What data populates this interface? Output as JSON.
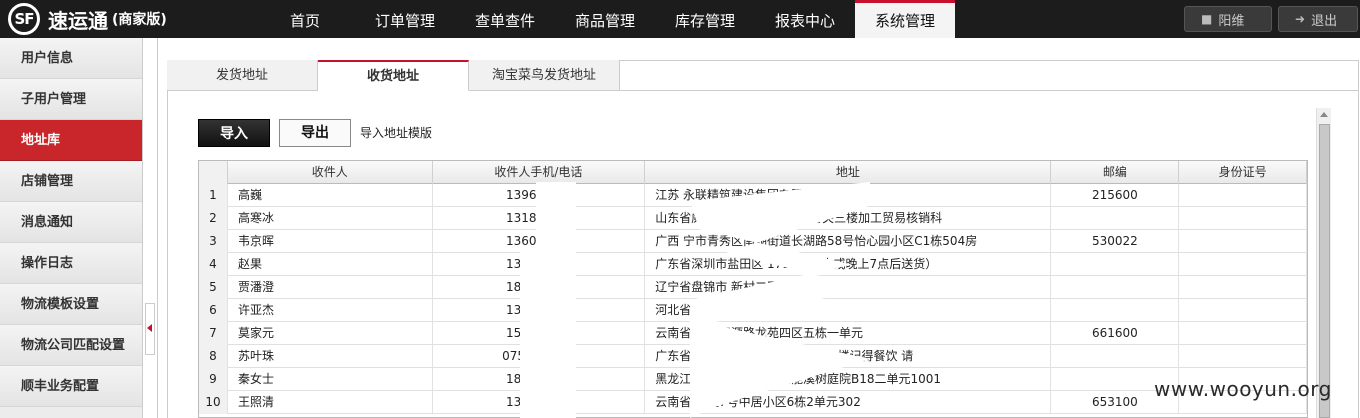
{
  "brand": {
    "mark": "SF",
    "name": "速运通",
    "edition": "(商家版)"
  },
  "nav": [
    "首页",
    "订单管理",
    "查单查件",
    "商品管理",
    "库存管理",
    "报表中心",
    "系统管理"
  ],
  "top_buttons": {
    "user": "阳维",
    "logout": "退出"
  },
  "sidebar": [
    "用户信息",
    "子用户管理",
    "地址库",
    "店铺管理",
    "消息通知",
    "操作日志",
    "物流模板设置",
    "物流公司匹配设置",
    "顺丰业务配置"
  ],
  "tabs": [
    "发货地址",
    "收货地址",
    "淘宝菜鸟发货地址"
  ],
  "toolbar": {
    "import": "导入",
    "export": "导出",
    "template": "导入地址模版"
  },
  "table": {
    "columns": [
      "收件人",
      "收件人手机/电话",
      "地址",
      "邮编",
      "身份证号"
    ],
    "rows": [
      [
        "1",
        "高巍",
        "13962   815",
        "江苏                               永联精筑建设集团有限公司",
        "215600"
      ],
      [
        "2",
        "高寒冰",
        "13181   096",
        "山东省威海市        号   道62号威海海关三楼加工贸易核销科",
        ""
      ],
      [
        "3",
        "韦京晖",
        "13607   263",
        "广西   宁市青秀区南湖街道长湖路58号怡心园小区C1栋504房",
        "530022"
      ],
      [
        "4",
        "赵果",
        "13420   252",
        "广东省深圳市盐田区          1711（周末或晚上7点后送货）",
        ""
      ],
      [
        "5",
        "贾潘澄",
        "18649   789",
        "辽宁省盘锦市           新村二区5号楼",
        ""
      ],
      [
        "6",
        "许亚杰",
        "13280   599",
        "河北省沧州市",
        ""
      ],
      [
        "7",
        "莫家元",
        "15822   996",
        "云南省             街道智源路龙苑四区五栋一单元",
        "661600"
      ],
      [
        "8",
        "苏叶珠",
        "07548   7799",
        "广东省汕头市             号金煌里附式KTV二楼记得餐饮 请",
        ""
      ],
      [
        "9",
        "秦女士",
        "18686   707",
        "黑龙江省哈尔滨       路大道辰能溪树庭院B18二单元1001",
        ""
      ],
      [
        "10",
        "王照清",
        "13577   637",
        "云南省玉         区7号中居小区6栋2单元302",
        "653100"
      ]
    ]
  },
  "watermark": "www.wooyun.org"
}
